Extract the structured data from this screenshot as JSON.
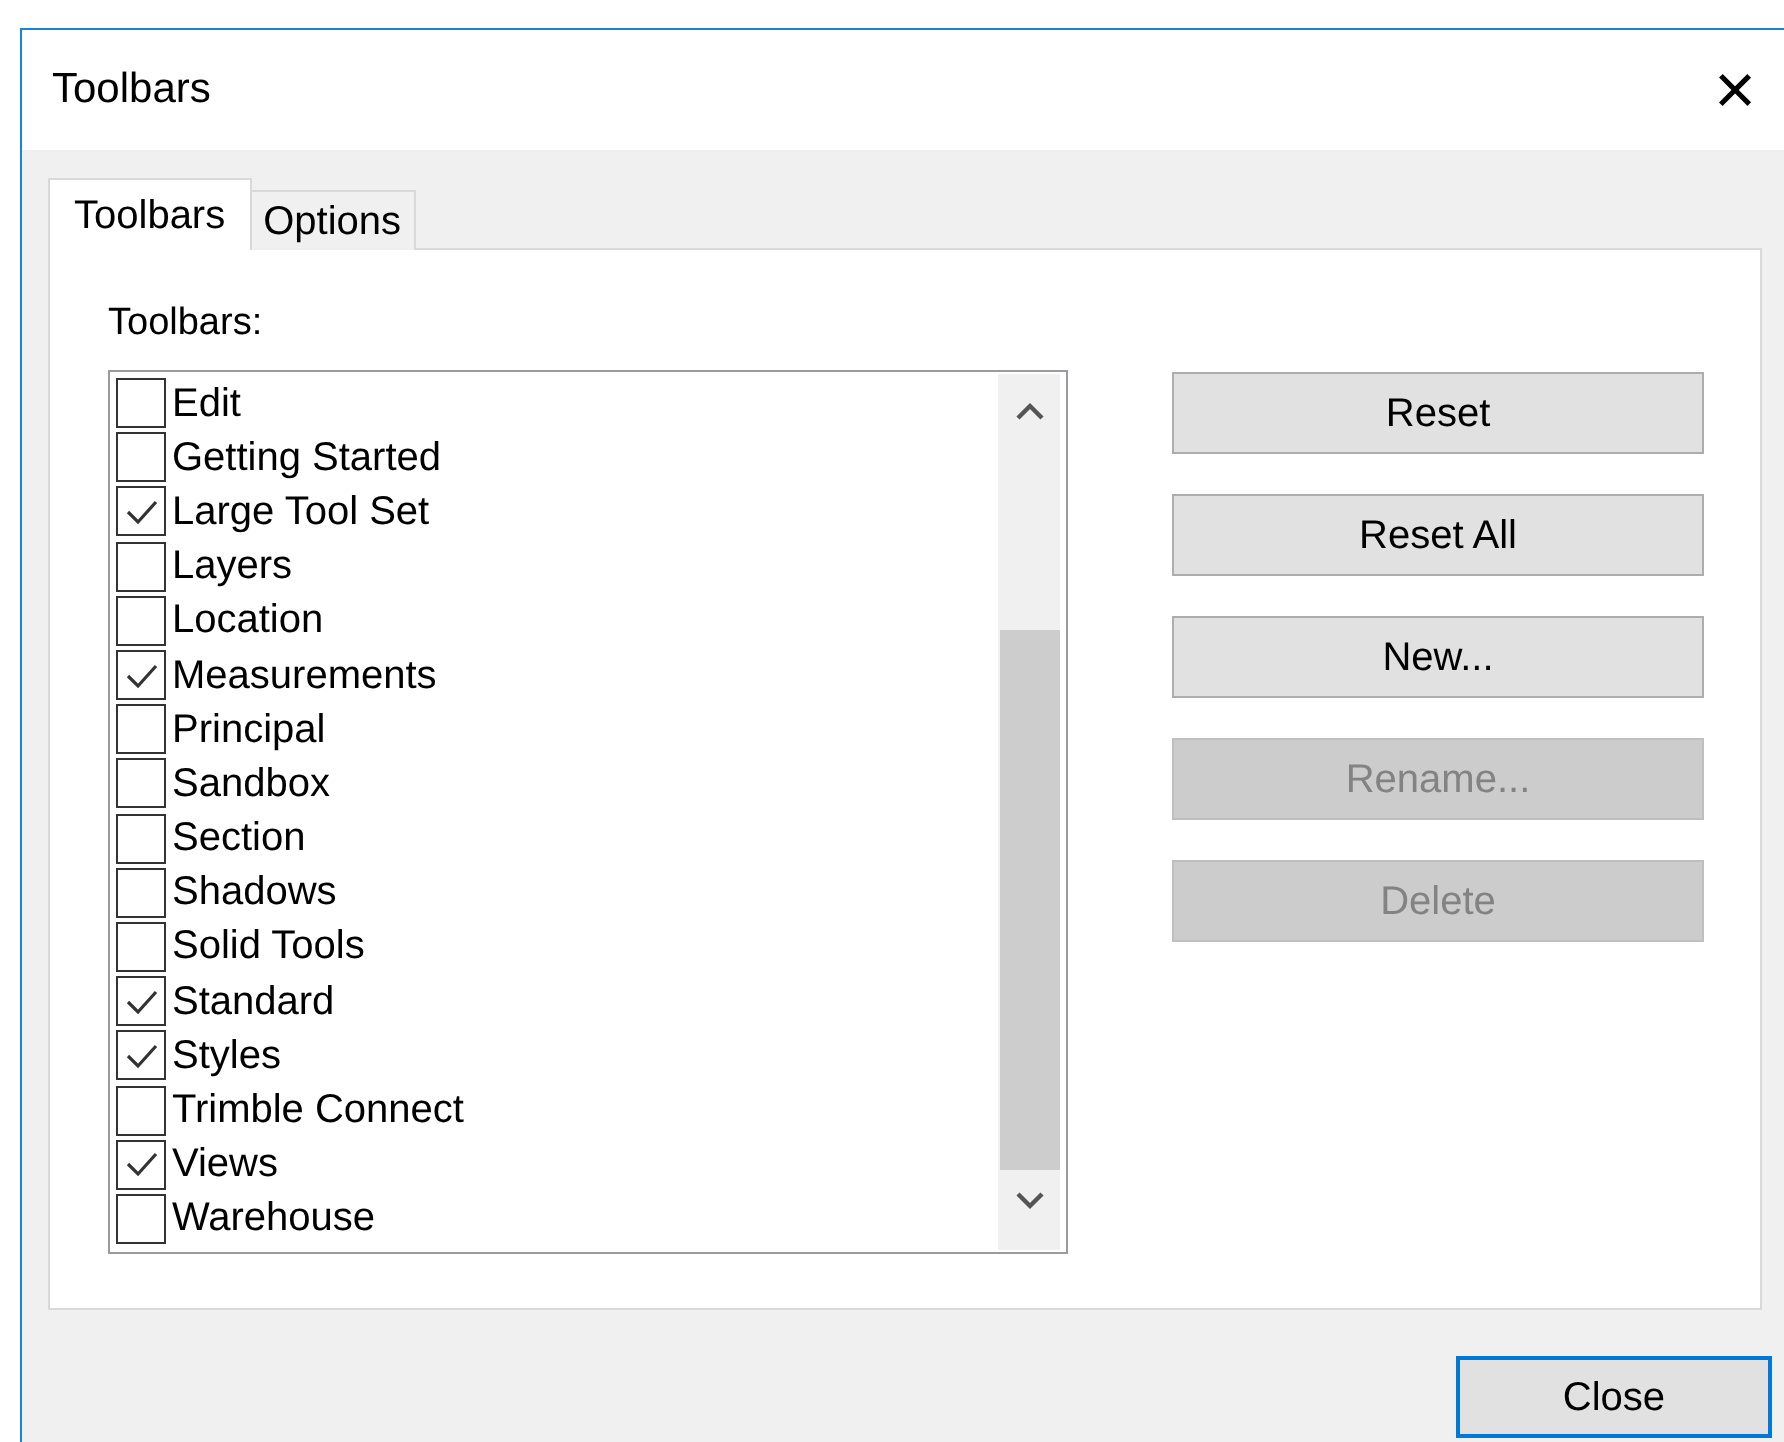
{
  "window": {
    "title": "Toolbars",
    "close": "×"
  },
  "tabs": [
    {
      "label": "Toolbars",
      "selected": true
    },
    {
      "label": "Options",
      "selected": false
    }
  ],
  "list_label": "Toolbars:",
  "toolbars": [
    {
      "label": "Edit",
      "checked": false
    },
    {
      "label": "Getting Started",
      "checked": false
    },
    {
      "label": "Large Tool Set",
      "checked": true
    },
    {
      "label": "Layers",
      "checked": false
    },
    {
      "label": "Location",
      "checked": false
    },
    {
      "label": "Measurements",
      "checked": true
    },
    {
      "label": "Principal",
      "checked": false
    },
    {
      "label": "Sandbox",
      "checked": false
    },
    {
      "label": "Section",
      "checked": false
    },
    {
      "label": "Shadows",
      "checked": false
    },
    {
      "label": "Solid Tools",
      "checked": false
    },
    {
      "label": "Standard",
      "checked": true
    },
    {
      "label": "Styles",
      "checked": true
    },
    {
      "label": "Trimble Connect",
      "checked": false
    },
    {
      "label": "Views",
      "checked": true
    },
    {
      "label": "Warehouse",
      "checked": false
    }
  ],
  "buttons": [
    {
      "label": "Reset",
      "disabled": false
    },
    {
      "label": "Reset All",
      "disabled": false
    },
    {
      "label": "New...",
      "disabled": false
    },
    {
      "label": "Rename...",
      "disabled": true
    },
    {
      "label": "Delete",
      "disabled": true
    }
  ],
  "footer_button": {
    "label": "Close",
    "default": true
  }
}
